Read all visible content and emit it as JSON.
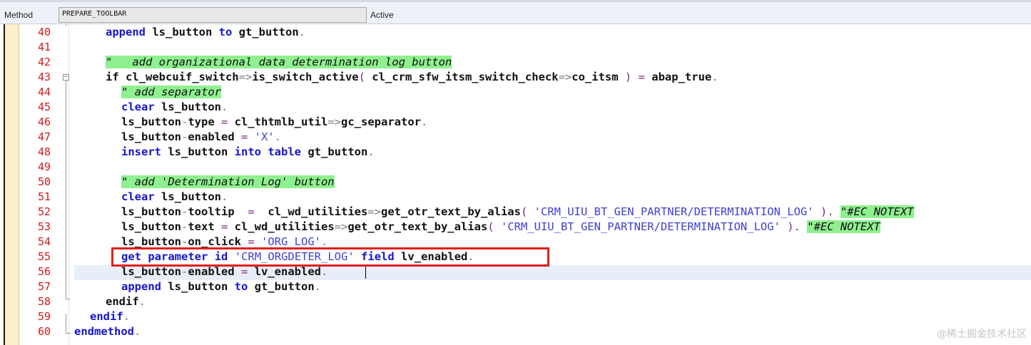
{
  "header": {
    "method_label": "Method",
    "method_value": "PREPARE_TOOLBAR",
    "status": "Active"
  },
  "lines": [
    {
      "n": "40"
    },
    {
      "n": "41"
    },
    {
      "n": "42"
    },
    {
      "n": "43"
    },
    {
      "n": "44"
    },
    {
      "n": "45"
    },
    {
      "n": "46"
    },
    {
      "n": "47"
    },
    {
      "n": "48"
    },
    {
      "n": "49"
    },
    {
      "n": "50"
    },
    {
      "n": "51"
    },
    {
      "n": "52"
    },
    {
      "n": "53"
    },
    {
      "n": "54"
    },
    {
      "n": "55"
    },
    {
      "n": "56"
    },
    {
      "n": "57"
    },
    {
      "n": "58"
    },
    {
      "n": "59"
    },
    {
      "n": "60"
    }
  ],
  "code": {
    "l40": {
      "k1": "append",
      "t1": " ls_button ",
      "k2": "to",
      "t2": " gt_button",
      "p": "."
    },
    "l42": {
      "c": "\"   add organizational data determination log button"
    },
    "l43": {
      "t1": "if cl_webcuif_switch",
      "o1": "=>",
      "t2": "is_switch_active",
      "o2": "(",
      "t3": " cl_crm_sfw_itsm_switch_check",
      "o3": "=>",
      "t4": "co_itsm ",
      "o4": ")",
      "o5": " = ",
      "t5": "abap_true",
      "p": "."
    },
    "l44": {
      "c": "\" add separator"
    },
    "l45": {
      "k1": "clear",
      "t1": " ls_button",
      "p": "."
    },
    "l46": {
      "t1": "ls_button",
      "o1": "-",
      "t2": "type",
      "o2": " = ",
      "t3": "cl_thtmlb_util",
      "o3": "=>",
      "t4": "gc_separator",
      "p": "."
    },
    "l47": {
      "t1": "ls_button",
      "o1": "-",
      "t2": "enabled",
      "o2": " = ",
      "s": "'X'",
      "p": "."
    },
    "l48": {
      "k1": "insert",
      "t1": " ls_button ",
      "k2": "into",
      "t2": " ",
      "k3": "table",
      "t3": " gt_button",
      "p": "."
    },
    "l50": {
      "c": "\" add 'Determination Log' button"
    },
    "l51": {
      "k1": "clear",
      "t1": " ls_button",
      "p": "."
    },
    "l52": {
      "t1": "ls_button",
      "o1": "-",
      "t2": "tooltip",
      "o2": "  =  ",
      "t3": "cl_wd_utilities",
      "o3": "=>",
      "t4": "get_otr_text_by_alias",
      "o4": "( ",
      "s": "'CRM_UIU_BT_GEN_PARTNER/DETERMINATION_LOG'",
      "o5": " ). ",
      "c": "\"#EC NOTEXT"
    },
    "l53": {
      "t1": "ls_button",
      "o1": "-",
      "t2": "text",
      "o2": " = ",
      "t3": "cl_wd_utilities",
      "o3": "=>",
      "t4": "get_otr_text_by_alias",
      "o4": "( ",
      "s": "'CRM_UIU_BT_GEN_PARTNER/DETERMINATION_LOG'",
      "o5": " ). ",
      "c": "\"#EC NOTEXT"
    },
    "l54": {
      "t1": "ls_button",
      "o1": "-",
      "t2": "on_click",
      "o2": " = ",
      "s": "'ORG_LOG'",
      "p": "."
    },
    "l55": {
      "k1": "get",
      "t1": " ",
      "k2": "parameter",
      "t2": " ",
      "k3": "id",
      "t3": " ",
      "s": "'CRM_ORGDETER_LOG'",
      "t4": " ",
      "k4": "field",
      "t5": " lv_enabled",
      "p": "."
    },
    "l56": {
      "t1": "ls_button",
      "o1": "-",
      "t2": "enabled",
      "o2": " = ",
      "t3": "lv_enabled",
      "p": "."
    },
    "l57": {
      "k1": "append",
      "t1": " ls_button ",
      "k2": "to",
      "t2": " gt_button",
      "p": "."
    },
    "l58": {
      "t1": "endif",
      "p": "."
    },
    "l59": {
      "t1": "endif",
      "p": "."
    },
    "l60": {
      "k1": "endmethod",
      "p": "."
    }
  },
  "watermark": "@稀土掘金技术社区"
}
